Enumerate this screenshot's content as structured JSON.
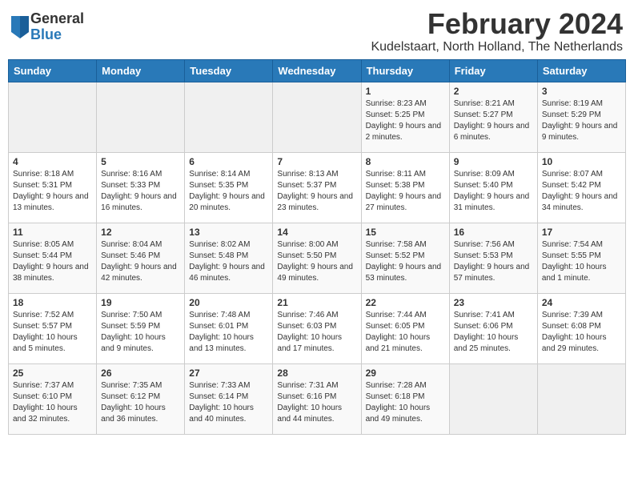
{
  "header": {
    "title": "February 2024",
    "subtitle": "Kudelstaart, North Holland, The Netherlands",
    "logo_general": "General",
    "logo_blue": "Blue"
  },
  "columns": [
    "Sunday",
    "Monday",
    "Tuesday",
    "Wednesday",
    "Thursday",
    "Friday",
    "Saturday"
  ],
  "weeks": [
    [
      {
        "day": "",
        "info": ""
      },
      {
        "day": "",
        "info": ""
      },
      {
        "day": "",
        "info": ""
      },
      {
        "day": "",
        "info": ""
      },
      {
        "day": "1",
        "info": "Sunrise: 8:23 AM\nSunset: 5:25 PM\nDaylight: 9 hours\nand 2 minutes."
      },
      {
        "day": "2",
        "info": "Sunrise: 8:21 AM\nSunset: 5:27 PM\nDaylight: 9 hours\nand 6 minutes."
      },
      {
        "day": "3",
        "info": "Sunrise: 8:19 AM\nSunset: 5:29 PM\nDaylight: 9 hours\nand 9 minutes."
      }
    ],
    [
      {
        "day": "4",
        "info": "Sunrise: 8:18 AM\nSunset: 5:31 PM\nDaylight: 9 hours\nand 13 minutes."
      },
      {
        "day": "5",
        "info": "Sunrise: 8:16 AM\nSunset: 5:33 PM\nDaylight: 9 hours\nand 16 minutes."
      },
      {
        "day": "6",
        "info": "Sunrise: 8:14 AM\nSunset: 5:35 PM\nDaylight: 9 hours\nand 20 minutes."
      },
      {
        "day": "7",
        "info": "Sunrise: 8:13 AM\nSunset: 5:37 PM\nDaylight: 9 hours\nand 23 minutes."
      },
      {
        "day": "8",
        "info": "Sunrise: 8:11 AM\nSunset: 5:38 PM\nDaylight: 9 hours\nand 27 minutes."
      },
      {
        "day": "9",
        "info": "Sunrise: 8:09 AM\nSunset: 5:40 PM\nDaylight: 9 hours\nand 31 minutes."
      },
      {
        "day": "10",
        "info": "Sunrise: 8:07 AM\nSunset: 5:42 PM\nDaylight: 9 hours\nand 34 minutes."
      }
    ],
    [
      {
        "day": "11",
        "info": "Sunrise: 8:05 AM\nSunset: 5:44 PM\nDaylight: 9 hours\nand 38 minutes."
      },
      {
        "day": "12",
        "info": "Sunrise: 8:04 AM\nSunset: 5:46 PM\nDaylight: 9 hours\nand 42 minutes."
      },
      {
        "day": "13",
        "info": "Sunrise: 8:02 AM\nSunset: 5:48 PM\nDaylight: 9 hours\nand 46 minutes."
      },
      {
        "day": "14",
        "info": "Sunrise: 8:00 AM\nSunset: 5:50 PM\nDaylight: 9 hours\nand 49 minutes."
      },
      {
        "day": "15",
        "info": "Sunrise: 7:58 AM\nSunset: 5:52 PM\nDaylight: 9 hours\nand 53 minutes."
      },
      {
        "day": "16",
        "info": "Sunrise: 7:56 AM\nSunset: 5:53 PM\nDaylight: 9 hours\nand 57 minutes."
      },
      {
        "day": "17",
        "info": "Sunrise: 7:54 AM\nSunset: 5:55 PM\nDaylight: 10 hours\nand 1 minute."
      }
    ],
    [
      {
        "day": "18",
        "info": "Sunrise: 7:52 AM\nSunset: 5:57 PM\nDaylight: 10 hours\nand 5 minutes."
      },
      {
        "day": "19",
        "info": "Sunrise: 7:50 AM\nSunset: 5:59 PM\nDaylight: 10 hours\nand 9 minutes."
      },
      {
        "day": "20",
        "info": "Sunrise: 7:48 AM\nSunset: 6:01 PM\nDaylight: 10 hours\nand 13 minutes."
      },
      {
        "day": "21",
        "info": "Sunrise: 7:46 AM\nSunset: 6:03 PM\nDaylight: 10 hours\nand 17 minutes."
      },
      {
        "day": "22",
        "info": "Sunrise: 7:44 AM\nSunset: 6:05 PM\nDaylight: 10 hours\nand 21 minutes."
      },
      {
        "day": "23",
        "info": "Sunrise: 7:41 AM\nSunset: 6:06 PM\nDaylight: 10 hours\nand 25 minutes."
      },
      {
        "day": "24",
        "info": "Sunrise: 7:39 AM\nSunset: 6:08 PM\nDaylight: 10 hours\nand 29 minutes."
      }
    ],
    [
      {
        "day": "25",
        "info": "Sunrise: 7:37 AM\nSunset: 6:10 PM\nDaylight: 10 hours\nand 32 minutes."
      },
      {
        "day": "26",
        "info": "Sunrise: 7:35 AM\nSunset: 6:12 PM\nDaylight: 10 hours\nand 36 minutes."
      },
      {
        "day": "27",
        "info": "Sunrise: 7:33 AM\nSunset: 6:14 PM\nDaylight: 10 hours\nand 40 minutes."
      },
      {
        "day": "28",
        "info": "Sunrise: 7:31 AM\nSunset: 6:16 PM\nDaylight: 10 hours\nand 44 minutes."
      },
      {
        "day": "29",
        "info": "Sunrise: 7:28 AM\nSunset: 6:18 PM\nDaylight: 10 hours\nand 49 minutes."
      },
      {
        "day": "",
        "info": ""
      },
      {
        "day": "",
        "info": ""
      }
    ]
  ]
}
